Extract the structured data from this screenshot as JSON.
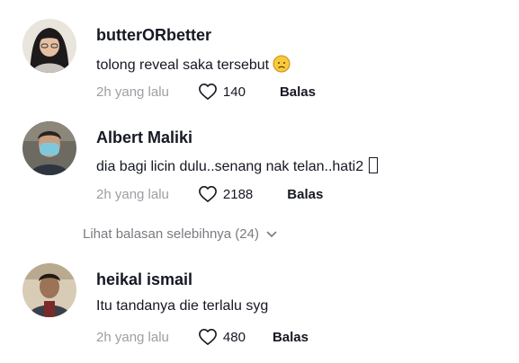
{
  "comments": [
    {
      "username": "butterORbetter",
      "text": "tolong reveal saka tersebut",
      "emoji": "sad-face-emoji",
      "time": "2h yang lalu",
      "likes": "140",
      "reply_label": "Balas"
    },
    {
      "username": "Albert Maliki",
      "text": "dia bagi licin dulu..senang nak telan..hati2",
      "emoji": "missing-glyph",
      "time": "2h yang lalu",
      "likes": "2188",
      "reply_label": "Balas"
    },
    {
      "username": "heikal ismail",
      "text": "Itu tandanya die terlalu syg",
      "time": "2h yang lalu",
      "likes": "480",
      "reply_label": "Balas"
    }
  ],
  "view_more_replies": "Lihat balasan selebihnya (24)",
  "icons": {
    "like": "heart-outline-icon",
    "expand": "chevron-down-icon"
  },
  "colors": {
    "text": "#161823",
    "muted": "#9d9ea3",
    "view_more": "#7a7b80"
  }
}
